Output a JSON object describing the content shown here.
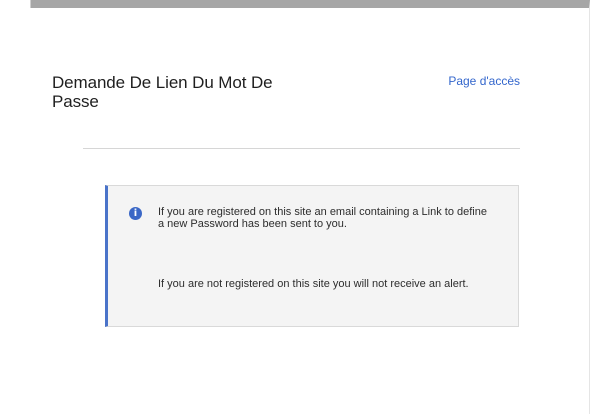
{
  "header": {
    "title": "Demande De Lien Du Mot De Passe",
    "login_link": "Page d'accès"
  },
  "info": {
    "icon": "info-icon",
    "color": "#3a67c6",
    "message_registered": "If you are registered on this site an email containing a Link to define a new Password has been sent to you.",
    "message_not_registered": "If you are not registered on this site you will not receive an alert."
  }
}
